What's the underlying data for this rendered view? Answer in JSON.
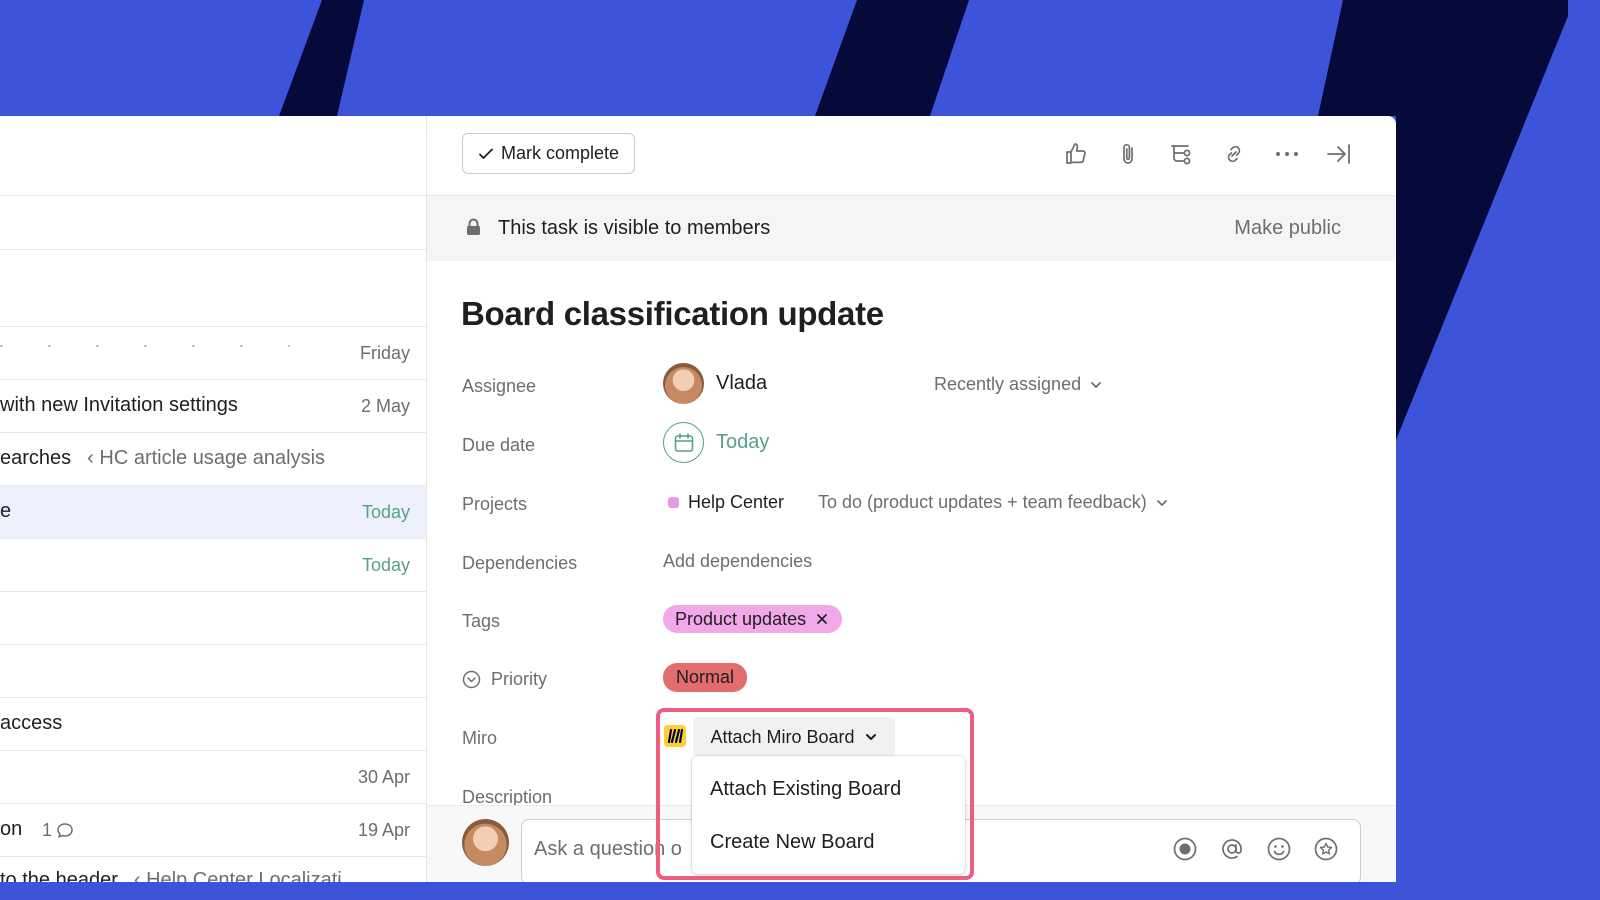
{
  "colors": {
    "background_blue": "#3d54da",
    "stripe_navy": "#050a3a",
    "success_green": "#58a182",
    "tag_pink": "#f0a8e9",
    "priority_red": "#e36c6c",
    "highlight": "#ee5c7f",
    "miro_yellow": "#ffd02f"
  },
  "task_list": {
    "rows": [
      {
        "title": "",
        "parent": "",
        "date": "Friday",
        "date_style": "normal",
        "comments": ""
      },
      {
        "title": "with new Invitation settings",
        "parent": "",
        "date": "2 May",
        "date_style": "normal",
        "comments": ""
      },
      {
        "title": "earches",
        "parent": "‹ HC article usage analysis",
        "date": "",
        "date_style": "normal",
        "comments": ""
      },
      {
        "title": "e",
        "parent": "",
        "date": "Today",
        "date_style": "today",
        "comments": ""
      },
      {
        "title": "",
        "parent": "",
        "date": "Today",
        "date_style": "today",
        "comments": ""
      },
      {
        "title": "",
        "parent": "",
        "date": "",
        "date_style": "normal",
        "comments": ""
      },
      {
        "title": "",
        "parent": "",
        "date": "",
        "date_style": "normal",
        "comments": ""
      },
      {
        "title": "access",
        "parent": "",
        "date": "",
        "date_style": "normal",
        "comments": ""
      },
      {
        "title": "",
        "parent": "",
        "date": "30 Apr",
        "date_style": "normal",
        "comments": ""
      },
      {
        "title": "on",
        "parent": "",
        "date": "19 Apr",
        "date_style": "normal",
        "comments": "1"
      },
      {
        "title": "to the header",
        "parent": "‹ Help Center Localizati",
        "date": "",
        "date_style": "normal",
        "comments": ""
      }
    ]
  },
  "toolbar": {
    "mark_complete_label": "Mark complete",
    "icons": [
      "like-icon",
      "attachment-icon",
      "subtask-icon",
      "link-icon",
      "more-icon",
      "close-panel-icon"
    ]
  },
  "visibility": {
    "text": "This task is visible to members",
    "make_public_label": "Make public"
  },
  "task": {
    "title": "Board classification update",
    "fields": {
      "assignee_label": "Assignee",
      "assignee_name": "Vlada",
      "recently_assigned_label": "Recently assigned",
      "due_date_label": "Due date",
      "due_date_value": "Today",
      "projects_label": "Projects",
      "project_name": "Help Center",
      "project_section": "To do (product updates + team feedback)",
      "dependencies_label": "Dependencies",
      "add_dependencies_label": "Add dependencies",
      "tags_label": "Tags",
      "tag_value": "Product updates",
      "priority_label": "Priority",
      "priority_value": "Normal",
      "miro_label": "Miro",
      "attach_miro_label": "Attach Miro Board",
      "description_label": "Description"
    }
  },
  "miro_menu": {
    "items": [
      "Attach Existing Board",
      "Create New Board"
    ]
  },
  "comment": {
    "placeholder": "Ask a question o",
    "icons": [
      "record-icon",
      "mention-icon",
      "emoji-icon",
      "star-icon"
    ]
  }
}
